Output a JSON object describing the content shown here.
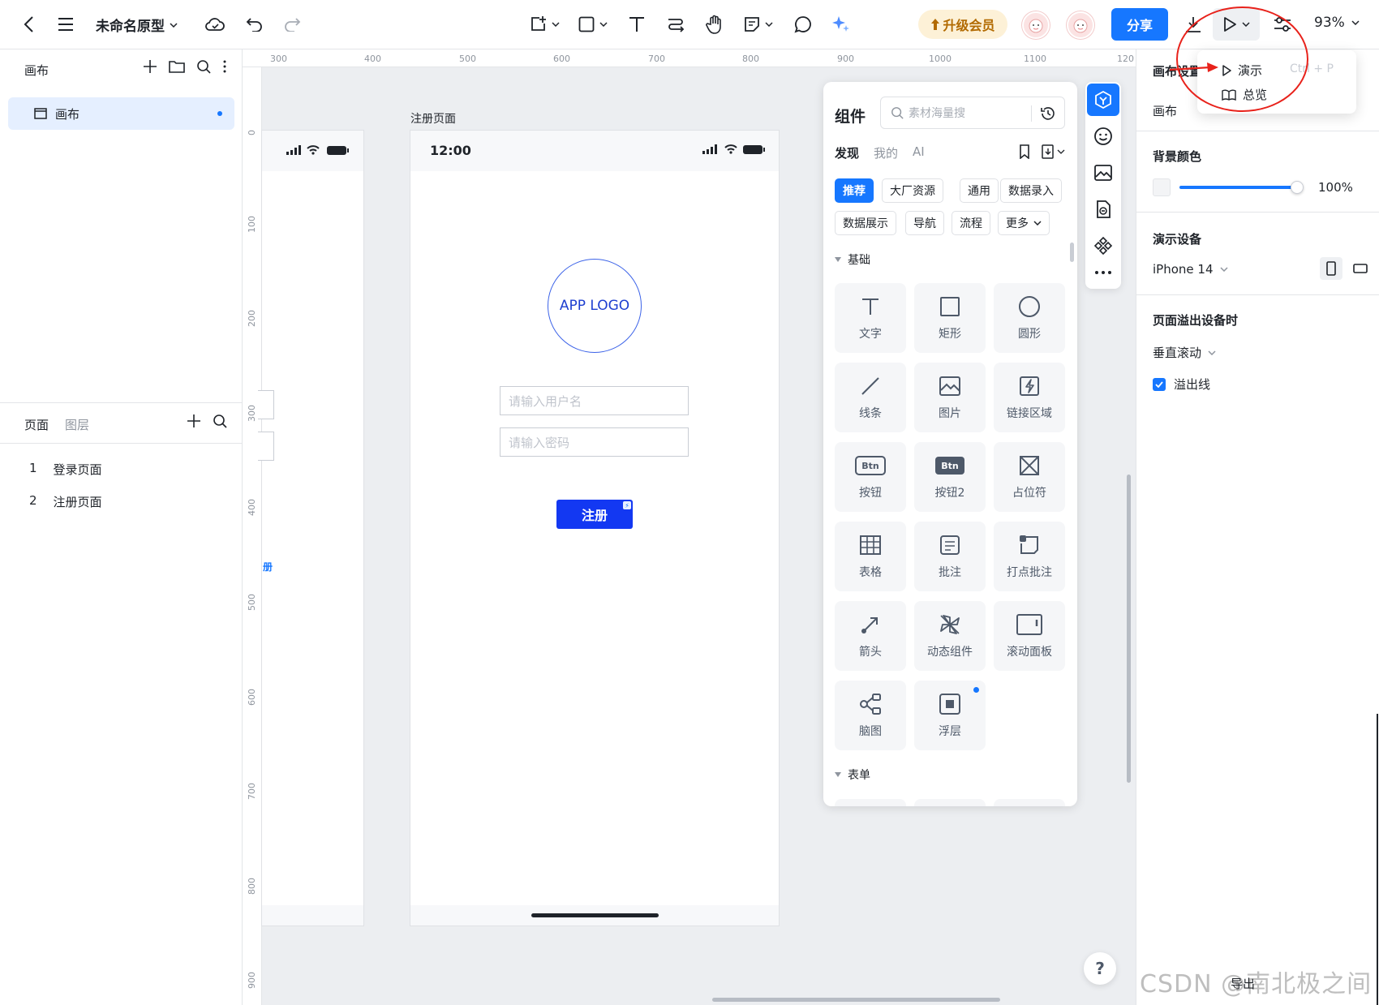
{
  "topbar": {
    "project_name": "未命名原型",
    "upgrade_label": "升级会员",
    "share_label": "分享",
    "zoom": "93%"
  },
  "left_panel": {
    "canvas_header": "画布",
    "canvas_item": "画布",
    "tabs": [
      "页面",
      "图层"
    ],
    "pages": [
      {
        "num": "1",
        "label": "登录页面"
      },
      {
        "num": "2",
        "label": "注册页面"
      }
    ]
  },
  "ruler": {
    "top": [
      "300",
      "400",
      "500",
      "600",
      "700",
      "800",
      "900",
      "1000",
      "1100",
      "120"
    ],
    "left": [
      "0",
      "100",
      "200",
      "300",
      "400",
      "500",
      "600",
      "700",
      "800",
      "900"
    ]
  },
  "canvas": {
    "frame_title": "注册页面",
    "phone": {
      "time": "12:00",
      "logo": "APP LOGO",
      "username_placeholder": "请输入用户名",
      "password_placeholder": "请输入密码",
      "register_label": "注册"
    },
    "left_frame_badge": "册"
  },
  "components": {
    "title": "组件",
    "search_placeholder": "素材海量搜",
    "tabs": [
      "发现",
      "我的",
      "AI"
    ],
    "chips": [
      "推荐",
      "大厂资源",
      "通用",
      "数据录入",
      "数据展示",
      "导航",
      "流程",
      "更多"
    ],
    "section_basic": "基础",
    "section_form": "表单",
    "tiles": [
      {
        "label": "文字",
        "icon": "text-icon"
      },
      {
        "label": "矩形",
        "icon": "rectangle-icon"
      },
      {
        "label": "圆形",
        "icon": "circle-icon"
      },
      {
        "label": "线条",
        "icon": "line-icon"
      },
      {
        "label": "图片",
        "icon": "image-icon"
      },
      {
        "label": "链接区域",
        "icon": "link-area-icon"
      },
      {
        "label": "按钮",
        "icon": "button-icon"
      },
      {
        "label": "按钮2",
        "icon": "button2-icon"
      },
      {
        "label": "占位符",
        "icon": "placeholder-icon"
      },
      {
        "label": "表格",
        "icon": "table-icon"
      },
      {
        "label": "批注",
        "icon": "note-icon"
      },
      {
        "label": "打点批注",
        "icon": "dot-note-icon"
      },
      {
        "label": "箭头",
        "icon": "arrow-icon"
      },
      {
        "label": "动态组件",
        "icon": "dynamic-icon"
      },
      {
        "label": "滚动面板",
        "icon": "scroll-panel-icon"
      },
      {
        "label": "脑图",
        "icon": "mindmap-icon"
      },
      {
        "label": "浮层",
        "icon": "overlay-icon"
      }
    ],
    "btn_text": "Btn"
  },
  "right_panel": {
    "title": "画布设置",
    "canvas_label": "画布",
    "bg_color_label": "背景颜色",
    "bg_opacity": "100%",
    "device_label": "演示设备",
    "device_value": "iPhone 14",
    "overflow_label": "页面溢出设备时",
    "overflow_value": "垂直滚动",
    "overflow_line_label": "溢出线",
    "export_label": "导出"
  },
  "popover": {
    "present_label": "演示",
    "present_shortcut": "Ctrl + P",
    "overview_label": "总览"
  },
  "help_label": "?",
  "watermark": "CSDN @南北极之间",
  "colors": {
    "accent": "#1677ff",
    "annotation": "#e8221b",
    "register_button": "#1338f2"
  }
}
